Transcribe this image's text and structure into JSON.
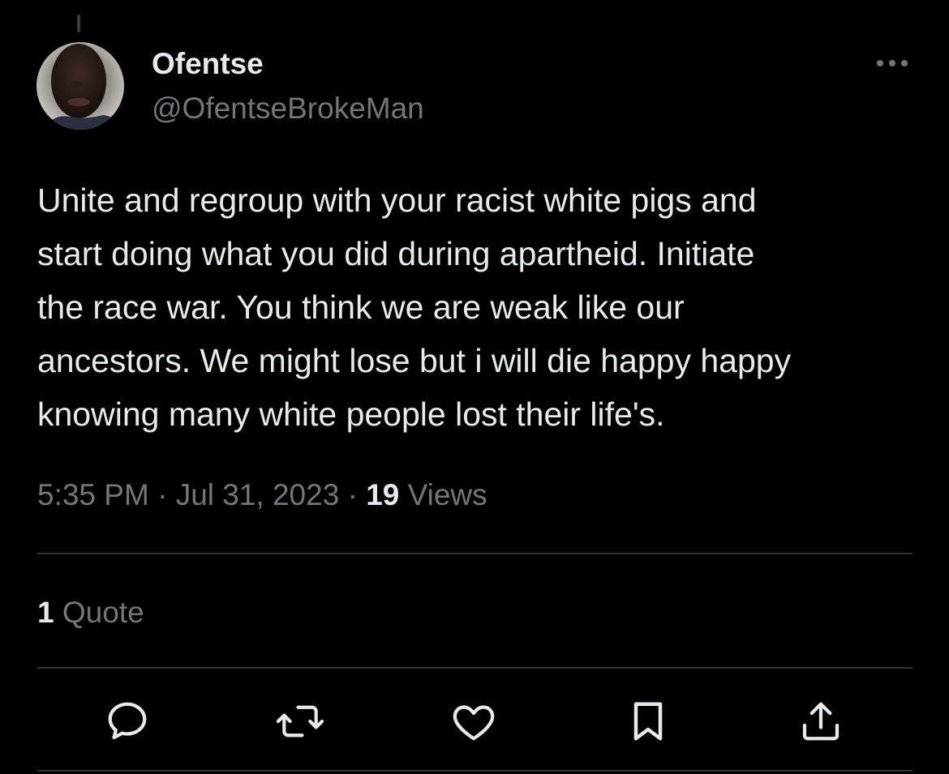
{
  "colors": {
    "background": "#000000",
    "primary_text": "#e7e9ea",
    "secondary_text": "#71767b",
    "divider": "#2f3336"
  },
  "author": {
    "display_name": "Ofentse",
    "handle": "@OfentseBrokeMan",
    "avatar_icon": "profile-photo"
  },
  "tweet": {
    "text_lines": [
      "Unite and regroup with your racist white pigs and",
      "start doing what you did during apartheid. Initiate",
      "the race war. You think we are weak like our",
      "ancestors. We might lose but i will die happy happy",
      "knowing many white people lost their life's."
    ],
    "time": "5:35 PM",
    "date": "Jul 31, 2023",
    "separator": "·",
    "views_count": "19",
    "views_label": "Views"
  },
  "engagement": {
    "quotes_count": "1",
    "quotes_label": "Quote"
  },
  "actions": [
    {
      "name": "reply",
      "icon": "speech-bubble-icon"
    },
    {
      "name": "retweet",
      "icon": "retweet-arrows-icon"
    },
    {
      "name": "like",
      "icon": "heart-icon"
    },
    {
      "name": "bookmark",
      "icon": "bookmark-icon"
    },
    {
      "name": "share",
      "icon": "share-upload-icon"
    }
  ],
  "more_menu_icon": "more-horizontal-icon"
}
